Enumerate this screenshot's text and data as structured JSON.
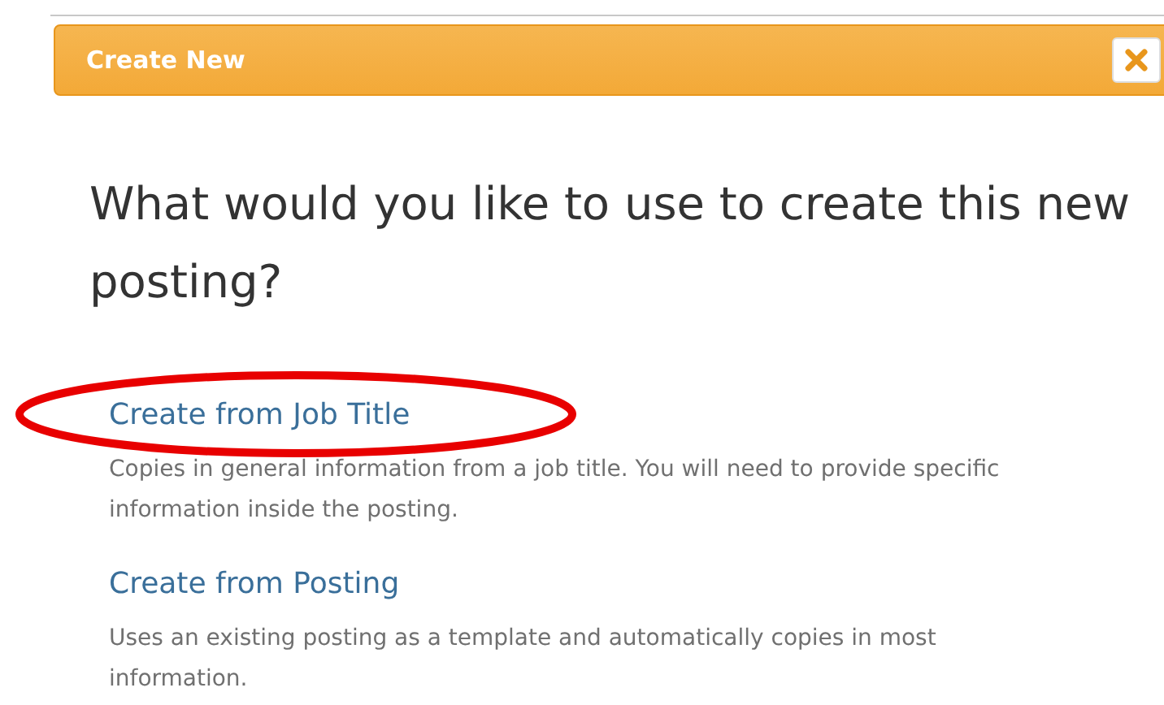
{
  "dialog": {
    "title": "Create New"
  },
  "heading": "What would you like to use to create this new posting?",
  "options": [
    {
      "label": "Create from Job Title",
      "description": "Copies in general information from a job title. You will need to provide specific information inside the posting.",
      "highlighted": true
    },
    {
      "label": "Create from Posting",
      "description": "Uses an existing posting as a template and automatically copies in most information.",
      "highlighted": false
    }
  ]
}
